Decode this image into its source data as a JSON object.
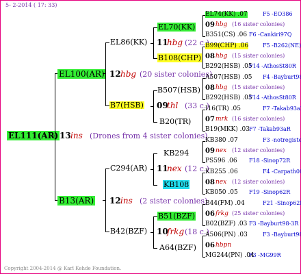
{
  "header": {
    "date": "5- 2-2014 ( 17: 33)"
  },
  "root": {
    "id": "EL111(AR)",
    "year": "13",
    "sign": "ins",
    "note": "(Drones from 4 sister colonies)"
  },
  "gen2": [
    {
      "id": "EL100(AR)",
      "year": "12",
      "sign": "hbg",
      "note": "(20 sister colonies)"
    },
    {
      "id": "B13(AR)",
      "year": "12",
      "sign": "ins",
      "note": "(2 sister colonies)"
    }
  ],
  "gen3": [
    {
      "id": "EL86(KK)",
      "year": "11",
      "sign": "hbg",
      "note": "(22 c.)"
    },
    {
      "id": "B7(HSB)",
      "year": "09",
      "sign": "thl",
      "note": "(33 c.)"
    },
    {
      "id": "C294(AR)",
      "year": "11",
      "sign": "nex",
      "note": "(12 c.)"
    },
    {
      "id": "B42(BZF)",
      "year": "10",
      "sign": "frkg",
      "note": "(18 c.)"
    }
  ],
  "gen4": [
    {
      "id": "EL70(KK)"
    },
    {
      "id": "B108(CHP)"
    },
    {
      "id": "B507(HSB)"
    },
    {
      "id": "B20(TR)"
    },
    {
      "id": "KB294"
    },
    {
      "id": "KB108"
    },
    {
      "id": "B51(BZF)"
    },
    {
      "id": "A64(BZF)"
    }
  ],
  "gen5": [
    {
      "a": "EL74(KK) .07",
      "ao": "F5 -EO386",
      "y": "09",
      "s": "hbg",
      "n": "(16 sister colonies)",
      "b": "B351(CS) .06",
      "bo": "F6 -Cankiri97Q"
    },
    {
      "a": "B99(CHP) .06",
      "ao": "F5 -B262(NE)",
      "y": "08",
      "s": "hbg",
      "n": "(15 sister colonies)",
      "b": "B292(HSB) .05",
      "bo": "F14 -AthosSt80R"
    },
    {
      "a": "A507(HSB) .05",
      "ao": "F4 -Bayburt98-3R",
      "y": "08",
      "s": "hbg",
      "n": "(15 sister colonies)",
      "b": "B292(HSB) .05",
      "bo": "F14 -AthosSt80R"
    },
    {
      "a": "I16(TR) .05",
      "ao": "F7 -Takab93aR",
      "y": "07",
      "s": "mrk",
      "n": "(16 sister colonies)",
      "b": "B19(MKK) .03",
      "bo": "F7 -Takab93aR"
    },
    {
      "a": "KB380 .07",
      "ao": "F3 -notregistered",
      "y": "09",
      "s": "nex",
      "n": "(12 sister colonies)",
      "b": "PS596 .06",
      "bo": "F18 -Sinop72R"
    },
    {
      "a": "KB255 .06",
      "ao": "F4 -Carpath00R",
      "y": "08",
      "s": "nex",
      "n": "(12 sister colonies)",
      "b": "KB050 .05",
      "bo": "F19 -Sinop62R"
    },
    {
      "a": "B44(FM) .04",
      "ao": "F21 -Sinop62R",
      "y": "06",
      "s": "frkg",
      "n": "(25 sister colonies)",
      "b": "B02(BZF) .03",
      "bo": "F3 -Bayburt98-3R"
    },
    {
      "a": "A506(PN) .03",
      "ao": "F3 -Bayburt98-3R",
      "y": "06",
      "s": "hbpn",
      "n": "",
      "b": "MG244(PN) .04",
      "bo": "F3 -MG99R"
    }
  ],
  "footer": {
    "copyright": "Copyright 2004-2014 @ Karl Kehde Foundation."
  }
}
